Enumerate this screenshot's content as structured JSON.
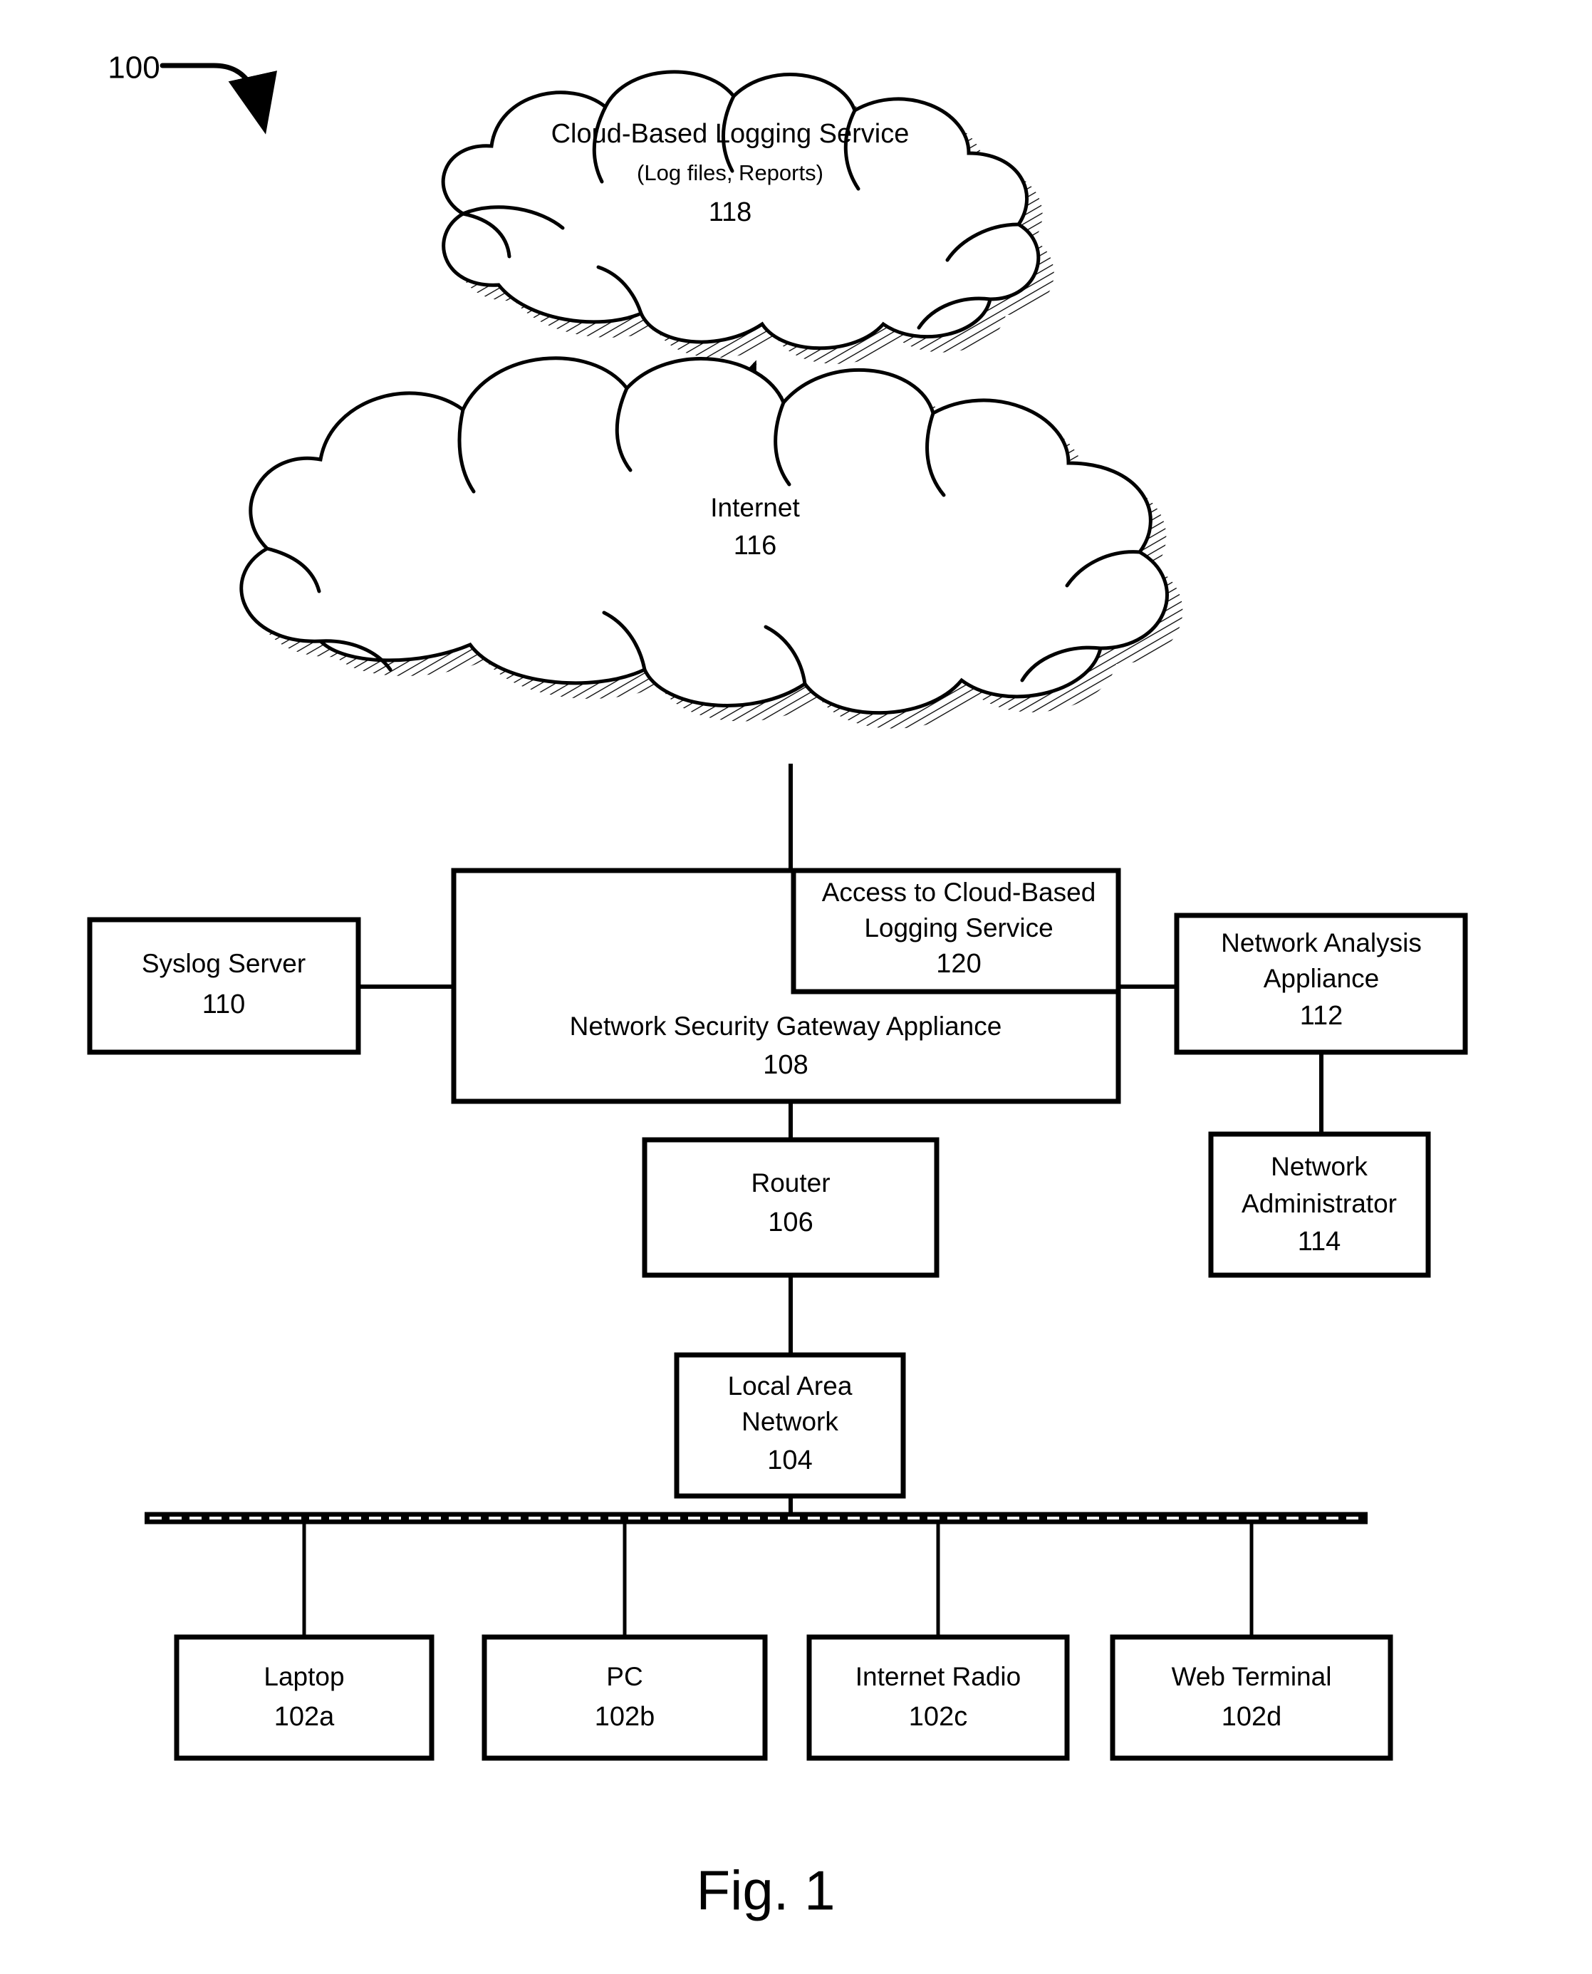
{
  "figure": {
    "caption": "Fig. 1",
    "system_callout": "100"
  },
  "clouds": [
    {
      "id": "cloud-logging-service",
      "title": "Cloud-Based Logging Service",
      "subtitle": "(Log files, Reports)",
      "ref": "118"
    },
    {
      "id": "cloud-internet",
      "title": "Internet",
      "subtitle": "",
      "ref": "116"
    }
  ],
  "boxes": {
    "syslog_server": {
      "label": "Syslog Server",
      "ref": "110"
    },
    "gateway": {
      "label": "Network Security Gateway Appliance",
      "ref": "108"
    },
    "cloud_access": {
      "label_line1": "Access to Cloud-Based",
      "label_line2": "Logging Service",
      "ref": "120"
    },
    "network_analysis": {
      "label_line1": "Network Analysis",
      "label_line2": "Appliance",
      "ref": "112"
    },
    "network_admin": {
      "label_line1": "Network",
      "label_line2": "Administrator",
      "ref": "114"
    },
    "router": {
      "label": "Router",
      "ref": "106"
    },
    "lan": {
      "label_line1": "Local Area",
      "label_line2": "Network",
      "ref": "104"
    }
  },
  "endpoints": [
    {
      "label": "Laptop",
      "ref": "102a"
    },
    {
      "label": "PC",
      "ref": "102b"
    },
    {
      "label": "Internet Radio",
      "ref": "102c"
    },
    {
      "label": "Web Terminal",
      "ref": "102d"
    }
  ],
  "colors": {
    "ink": "#000000",
    "paper": "#ffffff"
  }
}
